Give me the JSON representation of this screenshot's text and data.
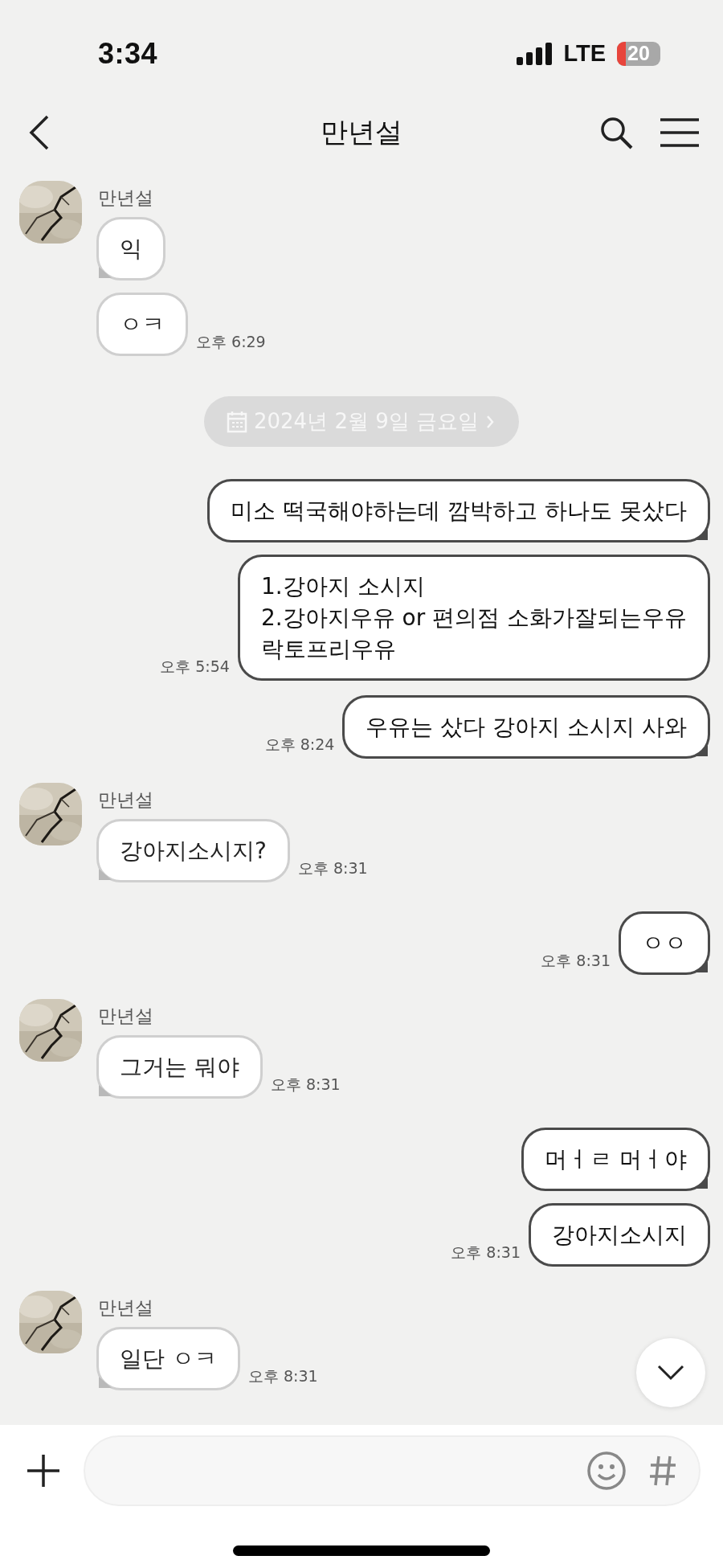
{
  "status_bar": {
    "time": "3:34",
    "network": "LTE",
    "battery": "20"
  },
  "header": {
    "title": "만년설"
  },
  "messages": [
    {
      "kind": "received",
      "sender": "만년설",
      "bubbles": [
        {
          "text": "익"
        },
        {
          "text": "ㅇㅋ",
          "time": "오후 6:29"
        }
      ]
    },
    {
      "kind": "date",
      "text": "2024년 2월 9일 금요일"
    },
    {
      "kind": "sent",
      "bubbles": [
        {
          "text": "미소 떡국해야하는데 깜박하고 하나도 못샀다"
        },
        {
          "text": "1.강아지 소시지\n2.강아지우유 or 편의점 소화가잘되는우유\n락토프리우유",
          "time": "오후 5:54"
        }
      ]
    },
    {
      "kind": "sent",
      "bubbles": [
        {
          "text": "우유는 샀다 강아지 소시지 사와",
          "time": "오후 8:24"
        }
      ]
    },
    {
      "kind": "received",
      "sender": "만년설",
      "bubbles": [
        {
          "text": "강아지소시지?",
          "time": "오후 8:31"
        }
      ]
    },
    {
      "kind": "sent",
      "bubbles": [
        {
          "text": "ㅇㅇ",
          "time": "오후 8:31"
        }
      ]
    },
    {
      "kind": "received",
      "sender": "만년설",
      "bubbles": [
        {
          "text": "그거는 뭐야",
          "time": "오후 8:31"
        }
      ]
    },
    {
      "kind": "sent",
      "bubbles": [
        {
          "text": "머ㅓㄹ 머ㅓ야"
        },
        {
          "text": "강아지소시지",
          "time": "오후 8:31"
        }
      ]
    },
    {
      "kind": "received",
      "sender": "만년설",
      "bubbles": [
        {
          "text": "일단 ㅇㅋ",
          "time": "오후 8:31"
        }
      ]
    }
  ]
}
